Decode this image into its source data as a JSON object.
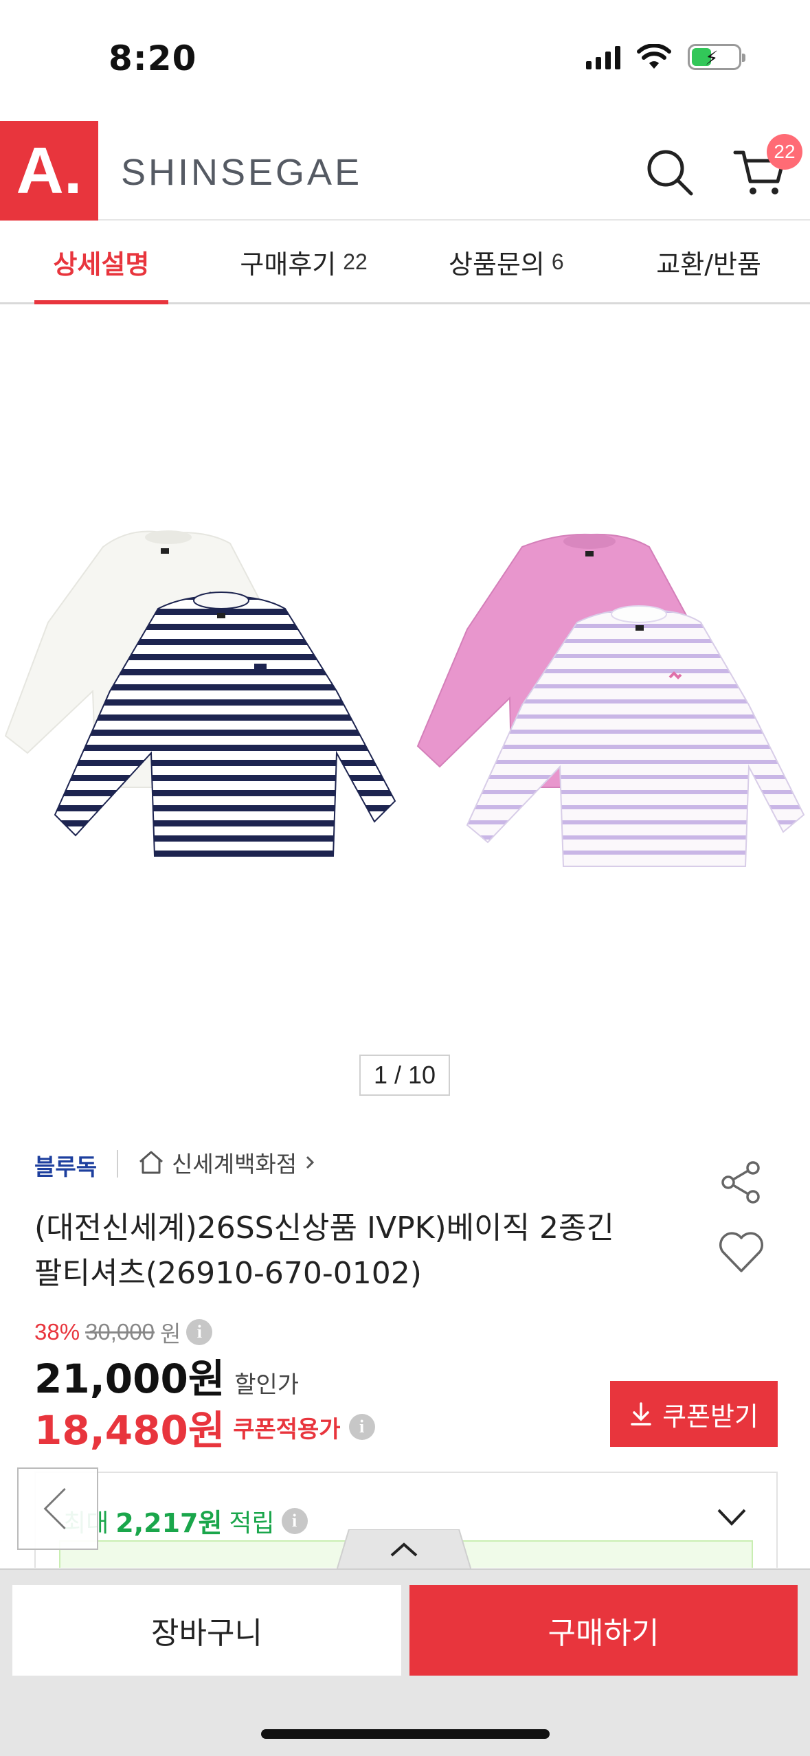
{
  "status_bar": {
    "time": "8:20"
  },
  "header": {
    "logo_text": "A.",
    "brand": "SHINSEGAE",
    "cart_count": "22",
    "accent_color": "#e8353d"
  },
  "tabs": [
    {
      "label": "상세설명",
      "count": ""
    },
    {
      "label": "구매후기",
      "count": "22"
    },
    {
      "label": "상품문의",
      "count": "6"
    },
    {
      "label": "교환/반품",
      "count": ""
    }
  ],
  "gallery": {
    "pager": "1 / 10"
  },
  "product": {
    "seller": "블루독",
    "store": "신세계백화점",
    "title_line1": "(대전신세계)26SS신상품  IVPK)베이직 2종긴",
    "title_line2": "팔티셔츠(26910-670-0102)",
    "discount_pct": "38%",
    "original_price": "30,000",
    "won": "원",
    "sale_price": "21,000원",
    "sale_label": "할인가",
    "coupon_price": "18,480원",
    "coupon_label": "쿠폰적용가",
    "coupon_button": "쿠폰받기",
    "points_prefix": "최대",
    "points_amount": "2,217원",
    "points_suffix": "적립"
  },
  "bottom_bar": {
    "cart_label": "장바구니",
    "buy_label": "구매하기"
  }
}
